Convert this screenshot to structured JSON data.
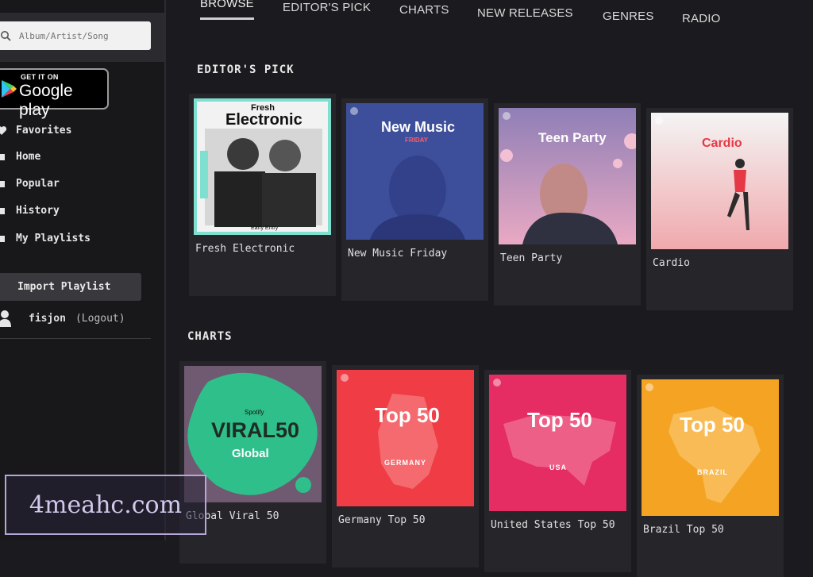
{
  "sidebar": {
    "search": {
      "placeholder": "Album/Artist/Song"
    },
    "store_badge": {
      "small": "GET IT ON",
      "big": "Google play"
    },
    "items": [
      {
        "label": "Favorites",
        "icon": "heart-icon"
      },
      {
        "label": "Home",
        "icon": "home-icon"
      },
      {
        "label": "Popular",
        "icon": "popular-icon"
      },
      {
        "label": "History",
        "icon": "history-icon"
      },
      {
        "label": "My Playlists",
        "icon": "playlist-icon"
      }
    ],
    "import_label": "Import Playlist",
    "user": {
      "name": "fisjon",
      "logout": "(Logout)"
    }
  },
  "tabs": [
    {
      "label": "BROWSE",
      "active": true
    },
    {
      "label": "EDITOR'S PICK"
    },
    {
      "label": "CHARTS"
    },
    {
      "label": "NEW RELEASES"
    },
    {
      "label": "GENRES"
    },
    {
      "label": "RADIO"
    }
  ],
  "editors_pick": {
    "title": "EDITOR'S PICK",
    "cards": [
      {
        "caption": "Fresh Electronic",
        "art_top": "Fresh",
        "art_title": "Electronic",
        "art_bottom": "Early Entry"
      },
      {
        "caption": "New Music Friday",
        "art_title": "New Music",
        "art_sub": "FRIDAY"
      },
      {
        "caption": "Teen Party",
        "art_title": "Teen Party"
      },
      {
        "caption": "Cardio",
        "art_title": "Cardio"
      }
    ]
  },
  "charts": {
    "title": "CHARTS",
    "cards": [
      {
        "caption": "Global Viral 50",
        "art_brand": "Spotify",
        "art_title": "VIRAL50",
        "art_sub": "Global"
      },
      {
        "caption": "Germany Top 50",
        "art_title": "Top 50",
        "art_sub": "GERMANY"
      },
      {
        "caption": "United States Top 50",
        "art_title": "Top 50",
        "art_sub": "USA"
      },
      {
        "caption": "Brazil Top 50",
        "art_title": "Top 50",
        "art_sub": "BRAZIL"
      }
    ]
  },
  "watermark": "4meahc.com",
  "colors": {
    "background": "#1b1a1e",
    "sidebar": "#18181b",
    "card": "#26252a",
    "germany": "#f03c45",
    "usa": "#e52c63",
    "brazil": "#f5a323",
    "viral": "#2fbf8b"
  }
}
